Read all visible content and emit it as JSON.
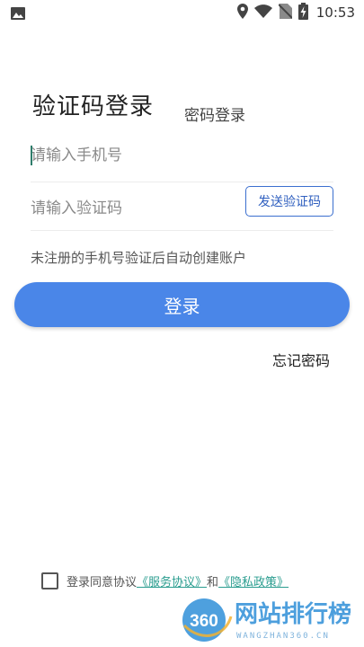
{
  "status_bar": {
    "time": "10:53",
    "icons": [
      "image-icon",
      "location-icon",
      "wifi-icon",
      "no-sim-icon",
      "battery-charging-icon"
    ]
  },
  "tabs": {
    "sms_login": "验证码登录",
    "password_login": "密码登录"
  },
  "phone_field": {
    "placeholder": "请输入手机号",
    "value": ""
  },
  "code_field": {
    "placeholder": "请输入验证码",
    "value": ""
  },
  "send_code_label": "发送验证码",
  "hint": "未注册的手机号验证后自动创建账户",
  "login_label": "登录",
  "forgot_label": "忘记密码",
  "agreement": {
    "prefix": "登录同意协议",
    "service_link": "《服务协议》",
    "connector": "和",
    "privacy_link": "《隐私政策》",
    "checked": false
  },
  "watermark": {
    "badge": "360",
    "title": "网站排行榜",
    "subtitle": "WANGZHAN360.CN"
  },
  "colors": {
    "primary": "#4a86e8",
    "link": "#2a9d8f",
    "send_border": "#3b6fcf"
  }
}
